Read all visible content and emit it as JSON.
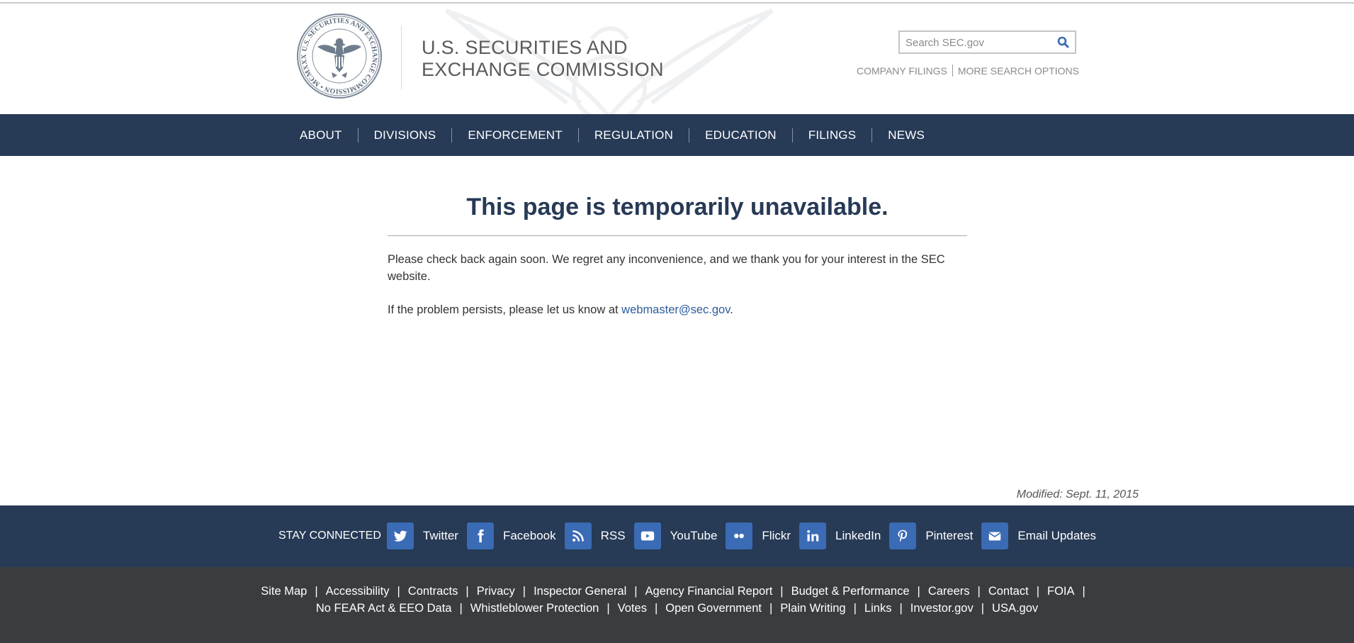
{
  "header": {
    "agency_line1": "U.S. SECURITIES AND",
    "agency_line2": "EXCHANGE COMMISSION",
    "seal_text": "U.S. SECURITIES AND EXCHANGE COMMISSION • MCMXXXIV •",
    "search_placeholder": "Search SEC.gov",
    "search_icon": "search-icon",
    "search_links": [
      "COMPANY FILINGS",
      "MORE SEARCH OPTIONS"
    ]
  },
  "nav": {
    "items": [
      "ABOUT",
      "DIVISIONS",
      "ENFORCEMENT",
      "REGULATION",
      "EDUCATION",
      "FILINGS",
      "NEWS"
    ]
  },
  "main": {
    "title": "This page is temporarily unavailable.",
    "paragraph1": "Please check back again soon. We regret any inconvenience, and we thank you for your interest in the SEC website.",
    "paragraph2_prefix": "If the problem persists, please let us know at ",
    "email_link": "webmaster@sec.gov",
    "paragraph2_suffix": "."
  },
  "modified": "Modified: Sept. 11, 2015",
  "social": {
    "label": "STAY CONNECTED",
    "items": [
      {
        "label": "Twitter",
        "icon": "twitter-icon"
      },
      {
        "label": "Facebook",
        "icon": "facebook-icon"
      },
      {
        "label": "RSS",
        "icon": "rss-icon"
      },
      {
        "label": "YouTube",
        "icon": "youtube-icon"
      },
      {
        "label": "Flickr",
        "icon": "flickr-icon"
      },
      {
        "label": "LinkedIn",
        "icon": "linkedin-icon"
      },
      {
        "label": "Pinterest",
        "icon": "pinterest-icon"
      },
      {
        "label": "Email Updates",
        "icon": "email-icon"
      }
    ]
  },
  "footer": {
    "row1": [
      "Site Map",
      "Accessibility",
      "Contracts",
      "Privacy",
      "Inspector General",
      "Agency Financial Report",
      "Budget & Performance",
      "Careers",
      "Contact",
      "FOIA"
    ],
    "row2": [
      "No FEAR Act & EEO Data",
      "Whistleblower Protection",
      "Votes",
      "Open Government",
      "Plain Writing",
      "Links",
      "Investor.gov",
      "USA.gov"
    ]
  },
  "colors": {
    "navy": "#273a56",
    "social_icon_bg": "#3a6bb4",
    "footer_bg": "#3a3d3f",
    "link": "#2c5c9c"
  }
}
